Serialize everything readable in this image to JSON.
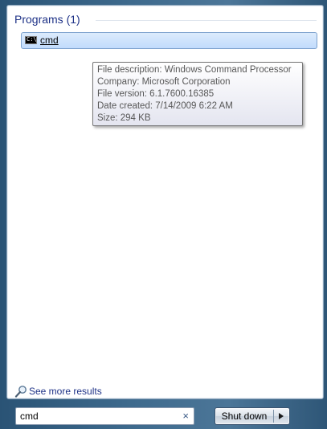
{
  "results": {
    "group_title": "Programs (1)",
    "items": [
      {
        "icon": "cmd-icon",
        "icon_glyph": "C:\\",
        "label": "cmd"
      }
    ]
  },
  "tooltip": {
    "lines": [
      "File description: Windows Command Processor",
      "Company: Microsoft Corporation",
      "File version: 6.1.7600.16385",
      "Date created: 7/14/2009 6:22 AM",
      "Size: 294 KB"
    ]
  },
  "see_more": {
    "icon": "magnifier-icon",
    "label": "See more results"
  },
  "search": {
    "value": "cmd",
    "clear_icon": "×"
  },
  "shutdown": {
    "label": "Shut down",
    "arrow_icon": "chevron-right-icon"
  },
  "colors": {
    "header_text": "#1e3287",
    "selection_bg": "#c1dbfc",
    "selection_border": "#7da2ce",
    "frame": "#2a5375"
  }
}
